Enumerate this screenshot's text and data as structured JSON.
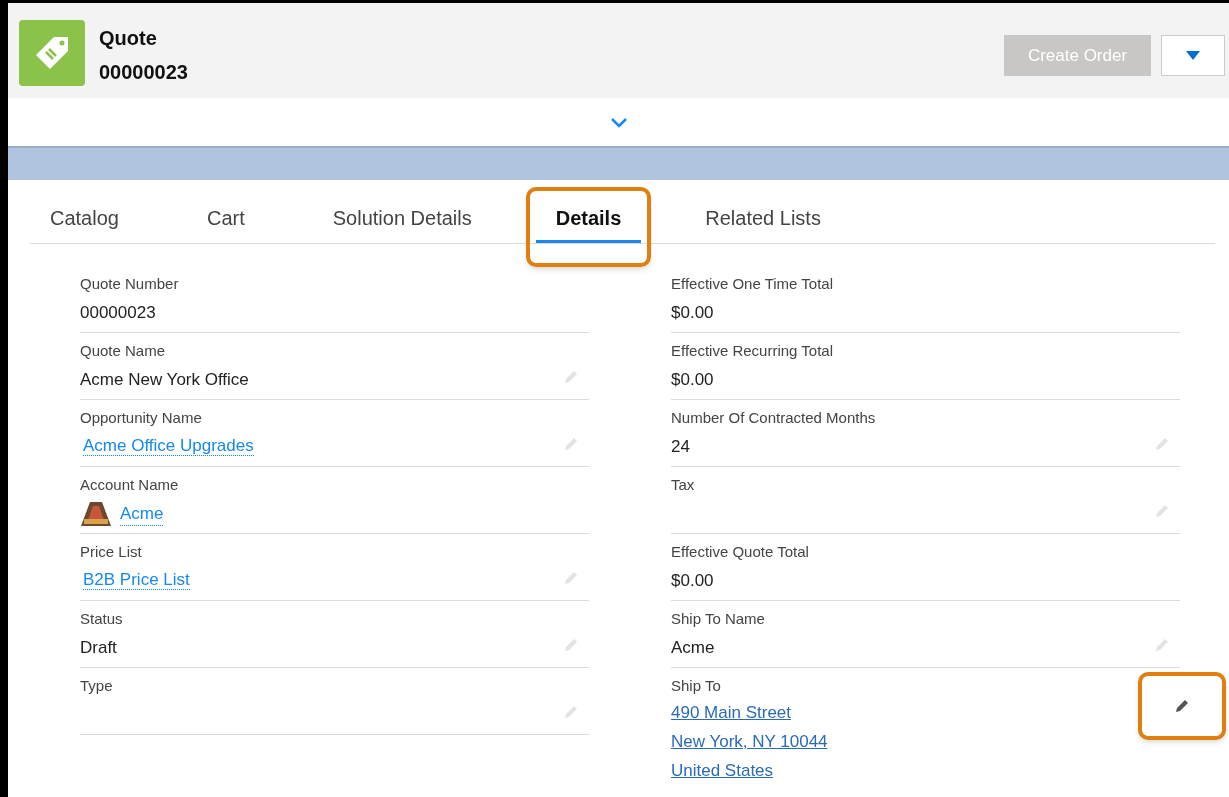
{
  "header": {
    "object_label": "Quote",
    "record_number": "00000023",
    "actions": [
      {
        "label": "Create Order",
        "disabled": true
      }
    ]
  },
  "tabs": [
    {
      "label": "Catalog",
      "selected": false,
      "highlighted": false
    },
    {
      "label": "Cart",
      "selected": false,
      "highlighted": false
    },
    {
      "label": "Solution Details",
      "selected": false,
      "highlighted": false
    },
    {
      "label": "Details",
      "selected": true,
      "highlighted": true
    },
    {
      "label": "Related Lists",
      "selected": false,
      "highlighted": false
    }
  ],
  "columns": [
    [
      {
        "label": "Quote Number",
        "kind": "text",
        "value": "00000023",
        "editable": false,
        "highlighted": false
      },
      {
        "label": "Quote Name",
        "kind": "text",
        "value": "Acme New York Office",
        "editable": true,
        "highlighted": false
      },
      {
        "label": "Opportunity Name",
        "kind": "link",
        "value": "Acme Office Upgrades",
        "editable": true,
        "highlighted": false
      },
      {
        "label": "Account Name",
        "kind": "account",
        "value": "Acme",
        "editable": false,
        "highlighted": false
      },
      {
        "label": "Price List",
        "kind": "link",
        "value": "B2B Price List",
        "editable": true,
        "highlighted": false
      },
      {
        "label": "Status",
        "kind": "text",
        "value": "Draft",
        "editable": true,
        "highlighted": false
      },
      {
        "label": "Type",
        "kind": "text",
        "editable": true,
        "highlighted": false
      }
    ],
    [
      {
        "label": "Effective One Time Total",
        "kind": "text",
        "value": "$0.00",
        "editable": false,
        "highlighted": false
      },
      {
        "label": "Effective Recurring Total",
        "kind": "text",
        "value": "$0.00",
        "editable": false,
        "highlighted": false
      },
      {
        "label": "Number Of Contracted Months",
        "kind": "text",
        "value": "24",
        "editable": true,
        "highlighted": false
      },
      {
        "label": "Tax",
        "kind": "text",
        "editable": true,
        "highlighted": false
      },
      {
        "label": "Effective Quote Total",
        "kind": "text",
        "value": "$0.00",
        "editable": false,
        "highlighted": false
      },
      {
        "label": "Ship To Name",
        "kind": "text",
        "value": "Acme",
        "editable": true,
        "highlighted": false
      },
      {
        "label": "Ship To",
        "kind": "address",
        "lines": [
          "490 Main Street",
          "New York, NY 10044",
          "United States"
        ],
        "editable": true,
        "highlighted": true
      }
    ]
  ]
}
